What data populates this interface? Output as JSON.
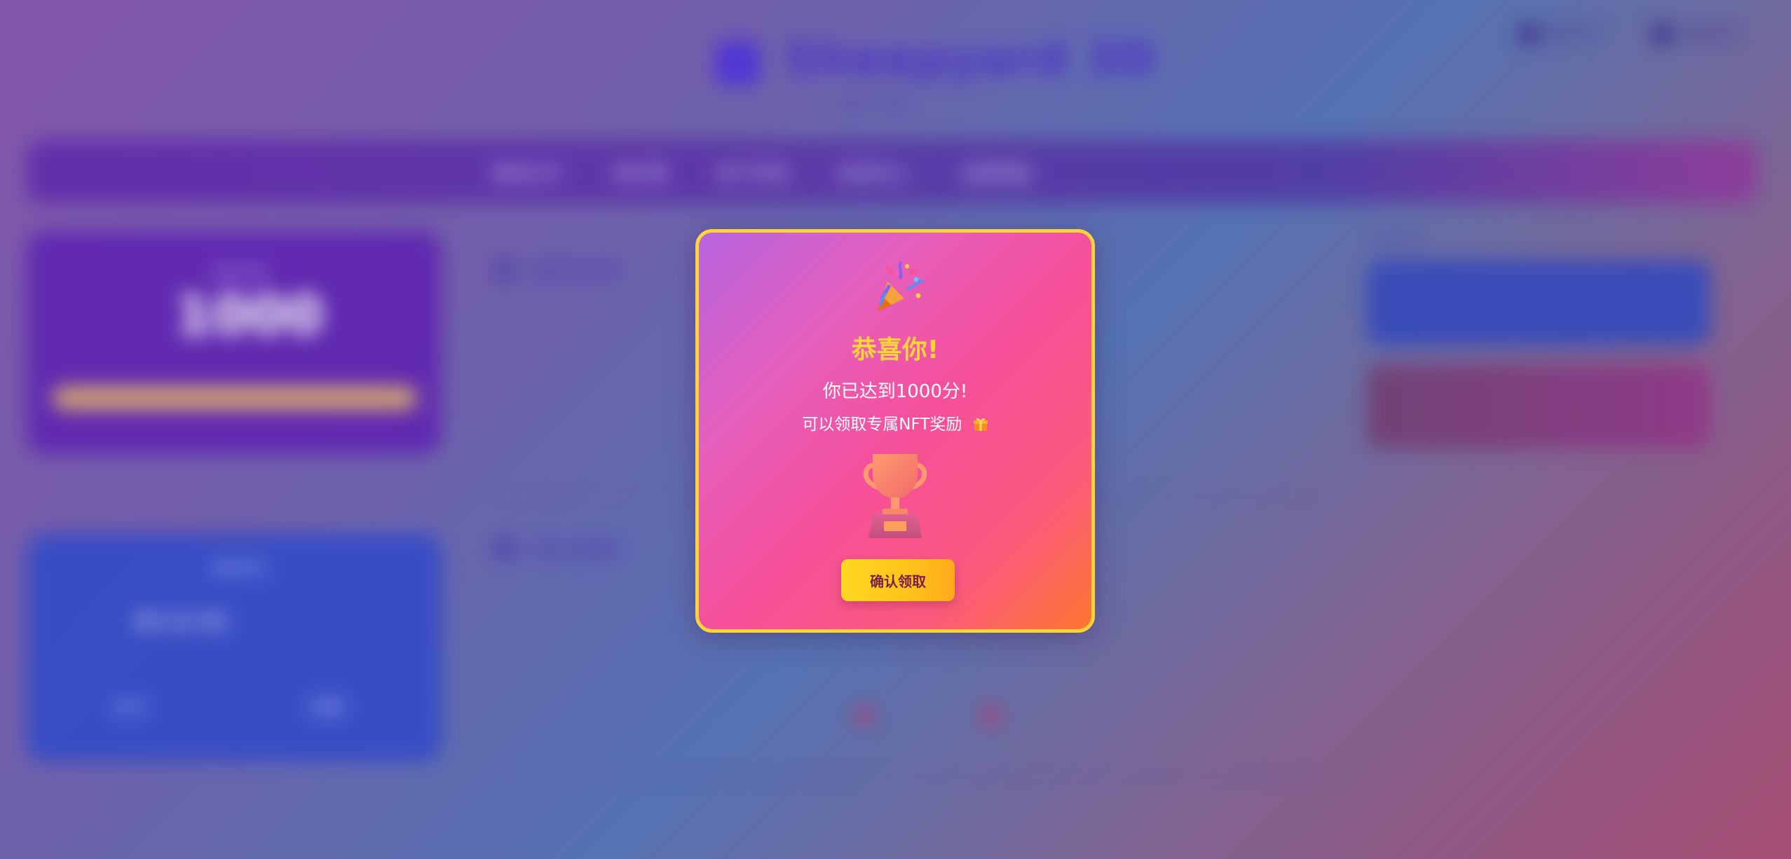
{
  "background": {
    "app_title": "Sheepyard 3D",
    "subtitle": "羊了个羊",
    "top_buttons": [
      "我的NFT",
      "连接钱包"
    ],
    "nav_items": [
      "游戏大厅",
      "排行榜",
      "NFT市场",
      "任务中心",
      "兑换奖励"
    ],
    "score_card": {
      "label": "当前分数",
      "value": "1000"
    },
    "time_card": {
      "label": "游戏时间",
      "value": "00:12:45",
      "items": [
        "关卡",
        "步数"
      ]
    },
    "sections": [
      "游戏说明",
      "积分规则"
    ],
    "side": {
      "label": "快捷操作"
    }
  },
  "modal": {
    "icon": "party-popper-icon",
    "title": "恭喜你!",
    "message": "你已达到1000分!",
    "sub_message": "可以领取专属NFT奖励",
    "gift_icon": "gift-icon",
    "trophy_icon": "trophy-icon",
    "confirm_label": "确认领取",
    "colors": {
      "border": "#ffd43a",
      "title": "#ffd43a",
      "button": "#ffc21a",
      "button_text": "#7a1f4a"
    }
  }
}
